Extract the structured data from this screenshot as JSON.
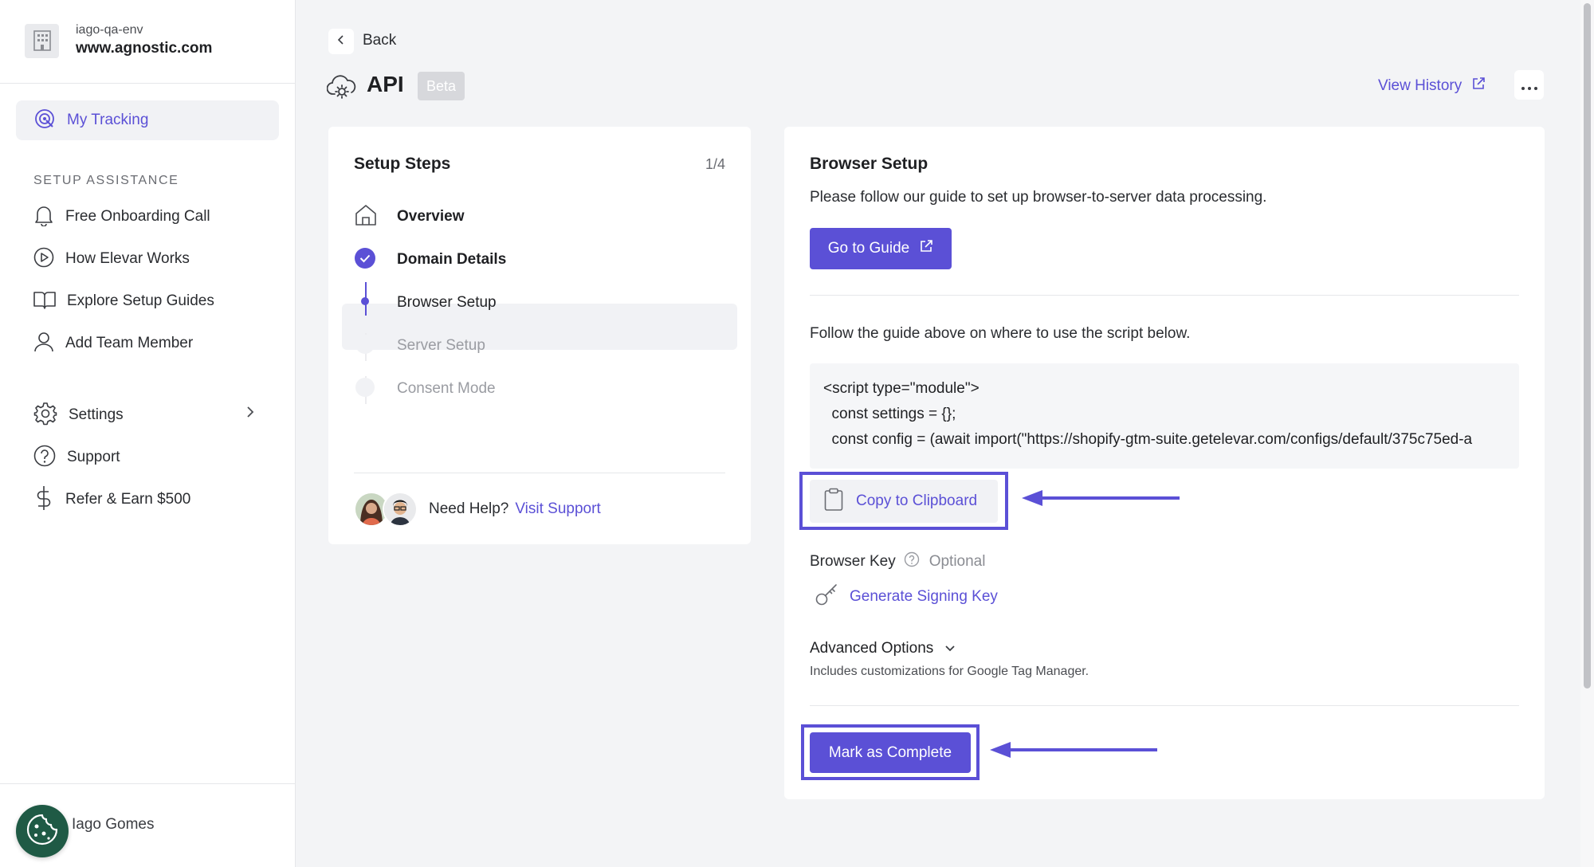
{
  "sidebar": {
    "org_env": "iago-qa-env",
    "org_domain": "www.agnostic.com",
    "active_item": "My Tracking",
    "section_title": "SETUP ASSISTANCE",
    "setup_items": [
      "Free Onboarding Call",
      "How Elevar Works",
      "Explore Setup Guides",
      "Add Team Member"
    ],
    "bottom_items": [
      "Settings",
      "Support",
      "Refer & Earn $500"
    ],
    "user_name": "Iago Gomes"
  },
  "header": {
    "back_label": "Back",
    "title": "API",
    "badge": "Beta",
    "view_history": "View History"
  },
  "steps": {
    "title": "Setup Steps",
    "count": "1/4",
    "items": [
      "Overview",
      "Domain Details",
      "Browser Setup",
      "Server Setup",
      "Consent Mode"
    ],
    "help_text": "Need Help?",
    "help_link": "Visit Support"
  },
  "setup": {
    "title": "Browser Setup",
    "description": "Please follow our guide to set up browser-to-server data processing.",
    "guide_button": "Go to Guide",
    "follow_text": "Follow the guide above on where to use the script below.",
    "code_lines": [
      "<script type=\"module\">",
      "  const settings = {};",
      "  const config = (await import(\"https://shopify-gtm-suite.getelevar.com/configs/default/375c75ed-a"
    ],
    "copy_button": "Copy to Clipboard",
    "key_label": "Browser Key",
    "key_optional": "Optional",
    "generate_key": "Generate Signing Key",
    "advanced_title": "Advanced Options",
    "advanced_desc": "Includes customizations for Google Tag Manager.",
    "complete_button": "Mark as Complete"
  },
  "colors": {
    "accent": "#5b50d6",
    "background": "#f3f4f6",
    "card": "#ffffff"
  }
}
